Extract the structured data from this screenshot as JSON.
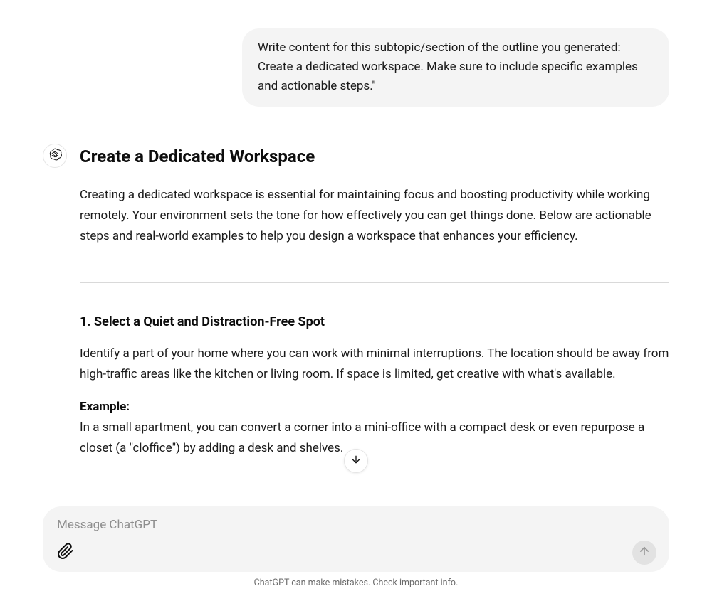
{
  "conversation": {
    "user_message": "Write content for this subtopic/section of the outline you generated: Create a dedicated workspace. Make sure to include specific examples and actionable steps.\"",
    "assistant": {
      "heading": "Create a Dedicated Workspace",
      "intro": "Creating a dedicated workspace is essential for maintaining focus and boosting productivity while working remotely. Your environment sets the tone for how effectively you can get things done. Below are actionable steps and real-world examples to help you design a workspace that enhances your efficiency.",
      "section1_heading": "1. Select a Quiet and Distraction-Free Spot",
      "section1_body": "Identify a part of your home where you can work with minimal interruptions. The location should be away from high-traffic areas like the kitchen or living room. If space is limited, get creative with what's available.",
      "example_label": "Example:",
      "example_body": "In a small apartment, you can convert a corner into a mini-office with a compact desk or even repurpose a closet (a \"cloffice\") by adding a desk and shelves."
    }
  },
  "composer": {
    "placeholder": "Message ChatGPT"
  },
  "footer": {
    "disclaimer": "ChatGPT can make mistakes. Check important info."
  }
}
